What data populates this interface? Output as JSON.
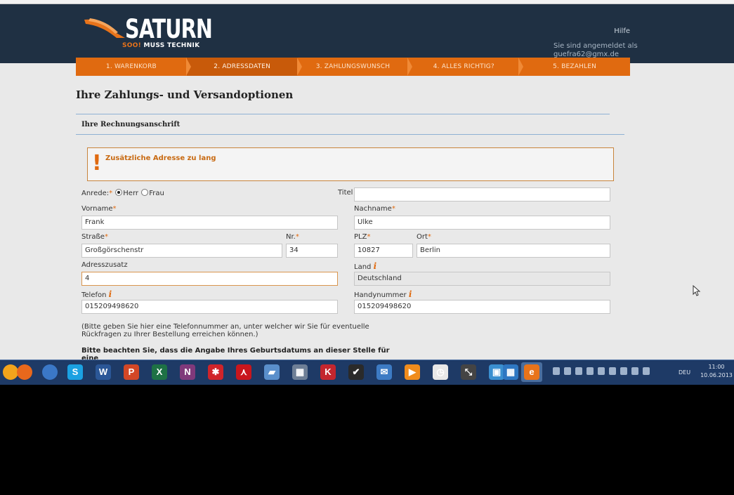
{
  "brand": {
    "logo_text": "SATURN",
    "tagline_highlight": "SOO!",
    "tagline_rest": " MUSS TECHNIK",
    "orange": "#e06a10",
    "navy": "#1f3043"
  },
  "header": {
    "help_label": "Hilfe",
    "login_info": "Sie sind angemeldet als guefra62@gmx.de"
  },
  "steps": [
    {
      "label": "1. WARENKORB"
    },
    {
      "label": "2. ADRESSDATEN"
    },
    {
      "label": "3. ZAHLUNGSWUNSCH"
    },
    {
      "label": "4. ALLES RICHTIG?"
    },
    {
      "label": "5. BEZAHLEN"
    }
  ],
  "page": {
    "title": "Ihre Zahlungs- und Versandoptionen",
    "section_title": "Ihre Rechnungsanschrift",
    "alert_icon": "exclamation-icon",
    "alert_text": "Zusätzliche Adresse zu lang"
  },
  "form": {
    "salutation_label": "Anrede:",
    "req_mark": "*",
    "option_herr": "Herr",
    "option_frau": "Frau",
    "selected_salutation": "Herr",
    "titel_label": "Titel",
    "titel_value": "",
    "vorname_label": "Vorname",
    "vorname_value": "Frank",
    "nachname_label": "Nachname",
    "nachname_value": "Ulke",
    "strasse_label": "Straße",
    "strasse_value": "Großgörschenstr",
    "nr_label": "Nr.",
    "nr_value": "34",
    "plz_label": "PLZ",
    "plz_value": "10827",
    "ort_label": "Ort",
    "ort_value": "Berlin",
    "adresszusatz_label": "Adresszusatz",
    "adresszusatz_value": "4",
    "land_label": "Land",
    "land_value": "Deutschland",
    "telefon_label": "Telefon",
    "telefon_value": "015209498620",
    "handy_label": "Handynummer",
    "handy_value": "015209498620",
    "info_glyph": "i",
    "phone_hint": "(Bitte geben Sie hier eine Telefonnummer an, unter welcher wir Sie für eventuelle Rückfragen zu Ihrer Bestellung erreichen können.)",
    "birth_note": "Bitte beachten Sie, dass die Angabe Ihres Geburtsdatums an dieser Stelle für eine"
  },
  "taskbar": {
    "apps": [
      {
        "name": "start-orb-icon",
        "glyph": "",
        "color": "#f2a41c"
      },
      {
        "name": "firefox-icon",
        "glyph": "",
        "color": "#e8681c"
      },
      {
        "name": "chrome-icon",
        "glyph": "",
        "color": "#3b78c7"
      },
      {
        "name": "skype-icon",
        "glyph": "S",
        "color": "#1ba1e2"
      },
      {
        "name": "word-icon",
        "glyph": "W",
        "color": "#2b5797"
      },
      {
        "name": "powerpoint-icon",
        "glyph": "P",
        "color": "#d24726"
      },
      {
        "name": "excel-icon",
        "glyph": "X",
        "color": "#1e7145"
      },
      {
        "name": "onenote-icon",
        "glyph": "N",
        "color": "#80397b"
      },
      {
        "name": "paint-app-icon",
        "glyph": "✱",
        "color": "#d0242a"
      },
      {
        "name": "pdf-reader-icon",
        "glyph": "⋏",
        "color": "#c9161d"
      },
      {
        "name": "notepad-icon",
        "glyph": "▰",
        "color": "#5a8fcb"
      },
      {
        "name": "calculator-icon",
        "glyph": "▦",
        "color": "#6e7f96"
      },
      {
        "name": "kaspersky-icon",
        "glyph": "K",
        "color": "#c4262e"
      },
      {
        "name": "ccleaner-icon",
        "glyph": "✔",
        "color": "#2a2a2a"
      },
      {
        "name": "email-icon",
        "glyph": "✉",
        "color": "#3d7bc4"
      },
      {
        "name": "media-player-icon",
        "glyph": "▶",
        "color": "#f08c1c"
      },
      {
        "name": "clock-app-icon",
        "glyph": "◷",
        "color": "#e8e8e8"
      },
      {
        "name": "snipping-tool-icon",
        "glyph": "⤡",
        "color": "#444"
      },
      {
        "name": "control-panel-icon",
        "glyph": "▣",
        "color": "#3a8fd0"
      },
      {
        "name": "remote-desktop-icon",
        "glyph": "▦",
        "color": "#2e77c2"
      },
      {
        "name": "browser-active-icon",
        "glyph": "e",
        "color": "#e8731a"
      }
    ],
    "language": "DEU",
    "time": "11:00",
    "date": "10.06.2013"
  }
}
